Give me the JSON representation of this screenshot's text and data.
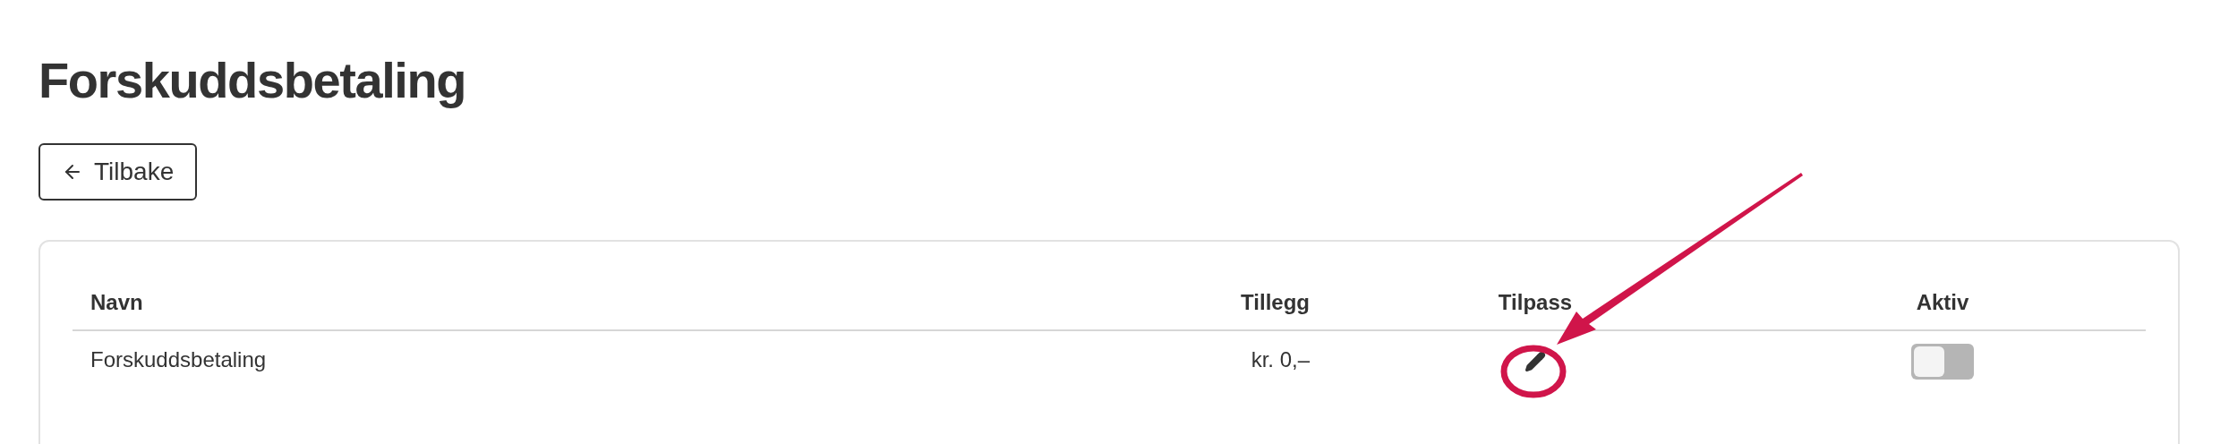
{
  "title": "Forskuddsbetaling",
  "back_button": {
    "label": "Tilbake"
  },
  "table": {
    "columns": [
      "Navn",
      "Tillegg",
      "Tilpass",
      "Aktiv"
    ],
    "rows": [
      {
        "name": "Forskuddsbetaling",
        "surcharge": "kr. 0,–",
        "active": false
      }
    ]
  }
}
